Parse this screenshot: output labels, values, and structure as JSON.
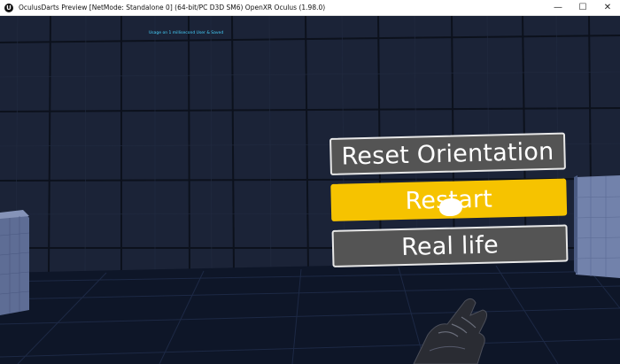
{
  "window": {
    "title": "OculusDarts Preview [NetMode: Standalone 0]  (64-bit/PC D3D SM6) OpenXR Oculus (1.98.0)",
    "app_icon_glyph": "U",
    "controls": [
      {
        "name": "minimize-icon",
        "glyph": "—"
      },
      {
        "name": "maximize-icon",
        "glyph": "☐"
      },
      {
        "name": "close-icon",
        "glyph": "✕"
      }
    ]
  },
  "viewport": {
    "debug_text": "Usage on 1 millisecond User & Saved",
    "menu": {
      "items": [
        {
          "label": "Reset Orientation",
          "selected": false
        },
        {
          "label": "Restart",
          "selected": true
        },
        {
          "label": "Real life",
          "selected": false
        }
      ]
    }
  },
  "colors": {
    "button_default": "#545454",
    "button_selected": "#f6c300",
    "button_border": "#e8e8e8",
    "debug_text": "#47d3ff",
    "wall": "#1a2236",
    "floor": "#0c1426"
  }
}
